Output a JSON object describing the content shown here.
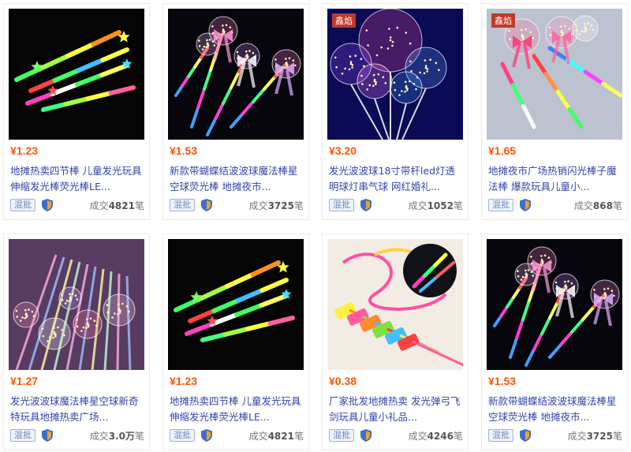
{
  "products": [
    {
      "price": "¥1.23",
      "title": "地摊热卖四节棒 儿童发光玩具伸缩发光棒荧光棒LE...",
      "badge": "混批",
      "sold_prefix": "成交",
      "sold_value": "4821",
      "sold_suffix": "笔",
      "image": "four-section-glow-sticks",
      "tag": ""
    },
    {
      "price": "¥1.53",
      "title": "新款带蝴蝶结波波球魔法棒星空球荧光棒 地摊夜市...",
      "badge": "混批",
      "sold_prefix": "成交",
      "sold_value": "3725",
      "sold_suffix": "笔",
      "image": "bow-bobo-ball-wands",
      "tag": ""
    },
    {
      "price": "¥3.20",
      "title": "发光波波球18寸带杆led灯透明球灯串气球 网红婚礼...",
      "badge": "混批",
      "sold_prefix": "成交",
      "sold_value": "1052",
      "sold_suffix": "笔",
      "image": "led-bobo-balloons",
      "tag": "鑫焰"
    },
    {
      "price": "¥1.65",
      "title": "地摊夜市广场热销闪光棒子魔法棒 爆款玩具儿童小...",
      "badge": "混批",
      "sold_prefix": "成交",
      "sold_value": "868",
      "sold_suffix": "笔",
      "image": "flash-magic-wands",
      "tag": "鑫焰"
    },
    {
      "price": "¥1.27",
      "title": "发光波波球魔法棒星空球新奇特玩具地摊热卖广场...",
      "badge": "混批",
      "sold_prefix": "成交",
      "sold_value": "3.0万",
      "sold_suffix": "笔",
      "image": "glowing-ball-wands",
      "tag": ""
    },
    {
      "price": "¥1.23",
      "title": "地摊热卖四节棒 儿童发光玩具伸缩发光棒荧光棒LE...",
      "badge": "混批",
      "sold_prefix": "成交",
      "sold_value": "4821",
      "sold_suffix": "笔",
      "image": "four-section-glow-sticks",
      "tag": ""
    },
    {
      "price": "¥0.38",
      "title": "厂家批发地摊热卖 发光弹弓飞剑玩具儿童小礼品...",
      "badge": "混批",
      "sold_prefix": "成交",
      "sold_value": "4246",
      "sold_suffix": "笔",
      "image": "slingshot-flying-arrows",
      "tag": ""
    },
    {
      "price": "¥1.53",
      "title": "新款带蝴蝶结波波球魔法棒星空球荧光棒 地摊夜市...",
      "badge": "混批",
      "sold_prefix": "成交",
      "sold_value": "3725",
      "sold_suffix": "笔",
      "image": "bow-bobo-ball-wands",
      "tag": ""
    }
  ]
}
